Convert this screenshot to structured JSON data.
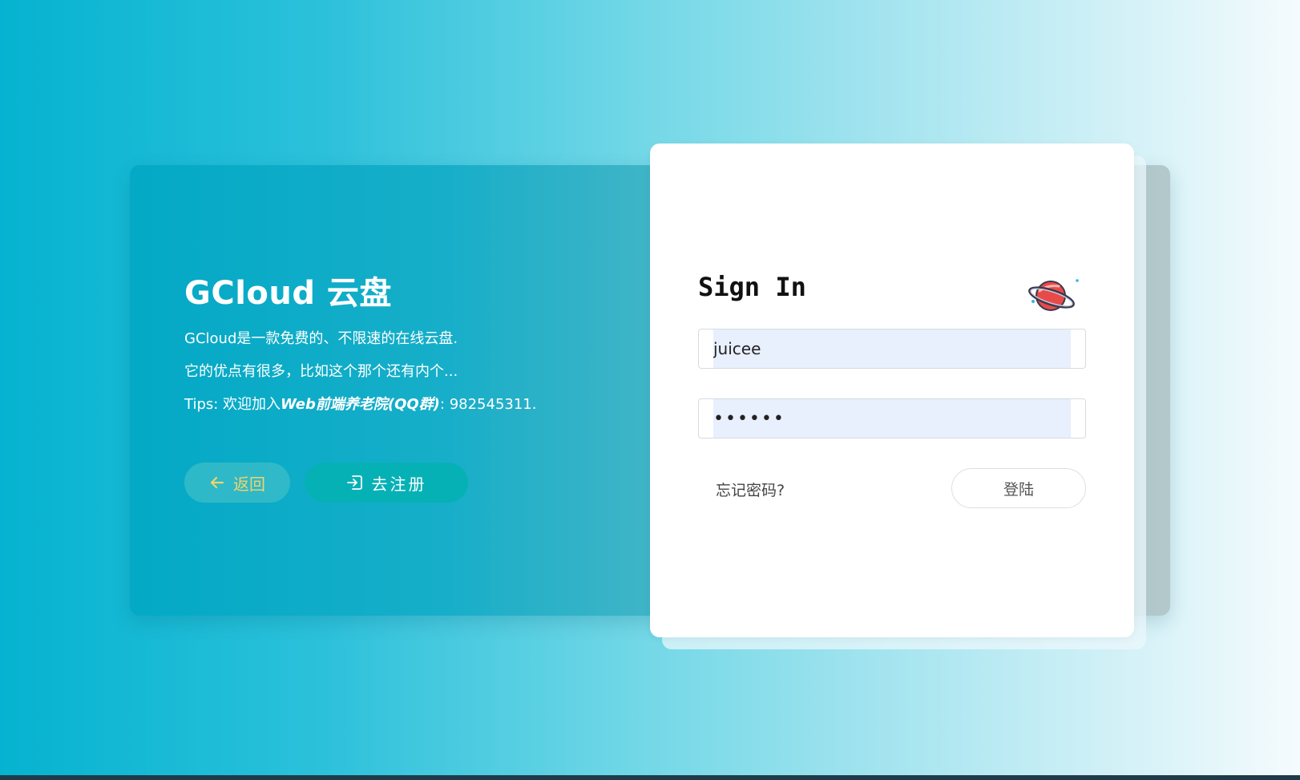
{
  "intro": {
    "title": "GCloud 云盘",
    "line1": "GCloud是一款免费的、不限速的在线云盘.",
    "line2": "它的优点有很多，比如这个那个还有内个...",
    "tips_prefix": "Tips: 欢迎加入",
    "tips_highlight": "Web前端养老院(QQ群)",
    "tips_suffix": ": 982545311."
  },
  "buttons": {
    "back_label": "返回",
    "register_label": "去注册"
  },
  "login": {
    "title": "Sign In",
    "username_value": "juicee",
    "password_value": "••••••",
    "forgot_label": "忘记密码?",
    "submit_label": "登陆"
  },
  "icons": {
    "back": "arrow-left-icon",
    "register": "sign-in-icon",
    "logo": "planet-icon"
  },
  "colors": {
    "accent_teal": "#06b1b6",
    "back_text": "#f3d36a",
    "input_bg": "#e8effd"
  }
}
